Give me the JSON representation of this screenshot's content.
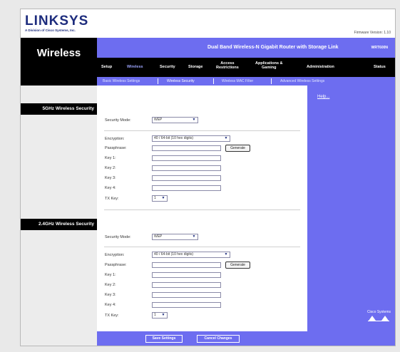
{
  "brand": {
    "logo": "LINKSYS",
    "logo_sub": "A Division of Cisco Systems, Inc.",
    "firmware": "Firmware Version: 1.10"
  },
  "section_title": "Wireless",
  "router_name": "Dual Band Wireless-N Gigabit Router with Storage Link",
  "model": "WRT600N",
  "nav": {
    "setup": "Setup",
    "wireless": "Wireless",
    "security": "Security",
    "storage": "Storage",
    "access_line1": "Access",
    "access_line2": "Restrictions",
    "apps_line1": "Applications &",
    "apps_line2": "Gaming",
    "administration": "Administration",
    "status": "Status"
  },
  "subnav": {
    "basic": "Basic Wireless Settings",
    "security": "Wireless Security",
    "mac": "Wireless MAC Filter",
    "advanced": "Advanced Wireless Settings"
  },
  "help_link": "Help...",
  "bands": [
    {
      "title": "5GHz Wireless Security",
      "security_mode_label": "Security Mode:",
      "security_mode_value": "WEP",
      "encryption_label": "Encryption:",
      "encryption_value": "40 / 64-bit (10 hex digits)",
      "passphrase_label": "Passphrase:",
      "generate_label": "Generate",
      "key1_label": "Key 1:",
      "key2_label": "Key 2:",
      "key3_label": "Key 3:",
      "key4_label": "Key 4:",
      "txkey_label": "TX Key:",
      "txkey_value": "1"
    },
    {
      "title": "2.4GHz Wireless Security",
      "security_mode_label": "Security Mode:",
      "security_mode_value": "WEP",
      "encryption_label": "Encryption:",
      "encryption_value": "40 / 64-bit (10 hex digits)",
      "passphrase_label": "Passphrase:",
      "generate_label": "Generate",
      "key1_label": "Key 1:",
      "key2_label": "Key 2:",
      "key3_label": "Key 3:",
      "key4_label": "Key 4:",
      "txkey_label": "TX Key:",
      "txkey_value": "1"
    }
  ],
  "buttons": {
    "save": "Save Settings",
    "cancel": "Cancel Changes"
  },
  "cisco_logo": "Cisco Systems",
  "colors": {
    "nav_blue": "#6d6df0",
    "dark": "#000000",
    "brand": "#1d2c7d"
  }
}
